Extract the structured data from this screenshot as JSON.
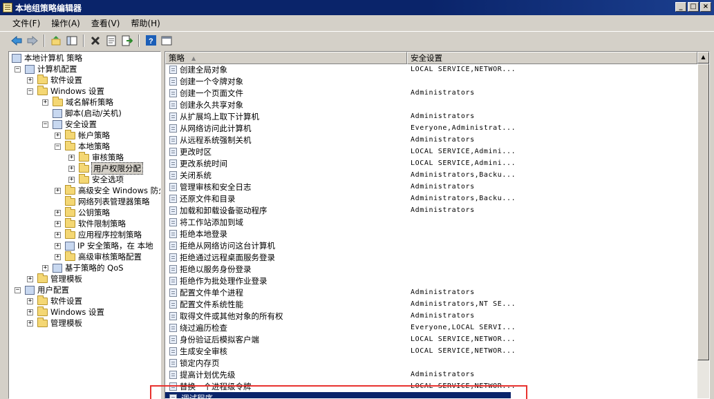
{
  "window": {
    "title": "本地组策略编辑器",
    "buttons": [
      "_",
      "□",
      "×"
    ]
  },
  "menu": [
    "文件(F)",
    "操作(A)",
    "查看(V)",
    "帮助(H)"
  ],
  "toolbar": [
    "back-icon",
    "forward-icon",
    "up-icon",
    "show-hide-tree-icon",
    "delete-icon",
    "properties-icon",
    "export-icon",
    "help-icon",
    "view-icon"
  ],
  "tree": [
    {
      "label": "本地计算机 策略",
      "indent": 0,
      "exp": "",
      "icon": "policy-icon"
    },
    {
      "label": "计算机配置",
      "indent": 1,
      "exp": "−",
      "icon": "computer-icon"
    },
    {
      "label": "软件设置",
      "indent": 2,
      "exp": "+",
      "icon": "folder-icon"
    },
    {
      "label": "Windows 设置",
      "indent": 2,
      "exp": "−",
      "icon": "folder-icon"
    },
    {
      "label": "域名解析策略",
      "indent": 3,
      "exp": "+",
      "icon": "folder-icon"
    },
    {
      "label": "脚本(启动/关机)",
      "indent": 3,
      "exp": "",
      "icon": "script-icon"
    },
    {
      "label": "安全设置",
      "indent": 3,
      "exp": "−",
      "icon": "security-icon"
    },
    {
      "label": "帐户策略",
      "indent": 4,
      "exp": "+",
      "icon": "folder-icon"
    },
    {
      "label": "本地策略",
      "indent": 4,
      "exp": "−",
      "icon": "folder-icon"
    },
    {
      "label": "审核策略",
      "indent": 5,
      "exp": "+",
      "icon": "folder-icon"
    },
    {
      "label": "用户权限分配",
      "indent": 5,
      "exp": "+",
      "icon": "folder-icon",
      "selected": true
    },
    {
      "label": "安全选项",
      "indent": 5,
      "exp": "+",
      "icon": "folder-icon"
    },
    {
      "label": "高级安全 Windows 防火",
      "indent": 4,
      "exp": "+",
      "icon": "folder-icon"
    },
    {
      "label": "网络列表管理器策略",
      "indent": 4,
      "exp": "",
      "icon": "folder-icon"
    },
    {
      "label": "公钥策略",
      "indent": 4,
      "exp": "+",
      "icon": "folder-icon"
    },
    {
      "label": "软件限制策略",
      "indent": 4,
      "exp": "+",
      "icon": "folder-icon"
    },
    {
      "label": "应用程序控制策略",
      "indent": 4,
      "exp": "+",
      "icon": "folder-icon"
    },
    {
      "label": "IP 安全策略，在 本地",
      "indent": 4,
      "exp": "+",
      "icon": "ipsec-icon"
    },
    {
      "label": "高级审核策略配置",
      "indent": 4,
      "exp": "+",
      "icon": "folder-icon"
    },
    {
      "label": "基于策略的 QoS",
      "indent": 3,
      "exp": "+",
      "icon": "chart-icon"
    },
    {
      "label": "管理模板",
      "indent": 2,
      "exp": "+",
      "icon": "folder-icon"
    },
    {
      "label": "用户配置",
      "indent": 1,
      "exp": "−",
      "icon": "user-icon"
    },
    {
      "label": "软件设置",
      "indent": 2,
      "exp": "+",
      "icon": "folder-icon"
    },
    {
      "label": "Windows 设置",
      "indent": 2,
      "exp": "+",
      "icon": "folder-icon"
    },
    {
      "label": "管理模板",
      "indent": 2,
      "exp": "+",
      "icon": "folder-icon"
    }
  ],
  "list": {
    "columns": [
      "策略",
      "安全设置"
    ],
    "rows": [
      {
        "policy": "创建全局对象",
        "setting": "LOCAL SERVICE,NETWOR..."
      },
      {
        "policy": "创建一个令牌对象",
        "setting": ""
      },
      {
        "policy": "创建一个页面文件",
        "setting": "Administrators"
      },
      {
        "policy": "创建永久共享对象",
        "setting": ""
      },
      {
        "policy": "从扩展坞上取下计算机",
        "setting": "Administrators"
      },
      {
        "policy": "从网络访问此计算机",
        "setting": "Everyone,Administrat..."
      },
      {
        "policy": "从远程系统强制关机",
        "setting": "Administrators"
      },
      {
        "policy": "更改时区",
        "setting": "LOCAL SERVICE,Admini..."
      },
      {
        "policy": "更改系统时间",
        "setting": "LOCAL SERVICE,Admini..."
      },
      {
        "policy": "关闭系统",
        "setting": "Administrators,Backu..."
      },
      {
        "policy": "管理审核和安全日志",
        "setting": "Administrators"
      },
      {
        "policy": "还原文件和目录",
        "setting": "Administrators,Backu..."
      },
      {
        "policy": "加载和卸载设备驱动程序",
        "setting": "Administrators"
      },
      {
        "policy": "将工作站添加到域",
        "setting": ""
      },
      {
        "policy": "拒绝本地登录",
        "setting": ""
      },
      {
        "policy": "拒绝从网络访问这台计算机",
        "setting": ""
      },
      {
        "policy": "拒绝通过远程桌面服务登录",
        "setting": ""
      },
      {
        "policy": "拒绝以服务身份登录",
        "setting": ""
      },
      {
        "policy": "拒绝作为批处理作业登录",
        "setting": ""
      },
      {
        "policy": "配置文件单个进程",
        "setting": "Administrators"
      },
      {
        "policy": "配置文件系统性能",
        "setting": "Administrators,NT SE..."
      },
      {
        "policy": "取得文件或其他对象的所有权",
        "setting": "Administrators"
      },
      {
        "policy": "绕过遍历检查",
        "setting": "Everyone,LOCAL SERVI..."
      },
      {
        "policy": "身份验证后模拟客户端",
        "setting": "LOCAL SERVICE,NETWOR..."
      },
      {
        "policy": "生成安全审核",
        "setting": "LOCAL SERVICE,NETWOR..."
      },
      {
        "policy": "锁定内存页",
        "setting": ""
      },
      {
        "policy": "提高计划优先级",
        "setting": "Administrators"
      },
      {
        "policy": "替换一个进程级令牌",
        "setting": "LOCAL SERVICE,NETWOR..."
      },
      {
        "policy": "调试程序",
        "setting": "",
        "selected": true
      }
    ]
  },
  "colors": {
    "title_bar": "#0a246a",
    "selection": "#0a246a",
    "highlight_box": "#e8322e",
    "chrome": "#d4d0c8"
  }
}
